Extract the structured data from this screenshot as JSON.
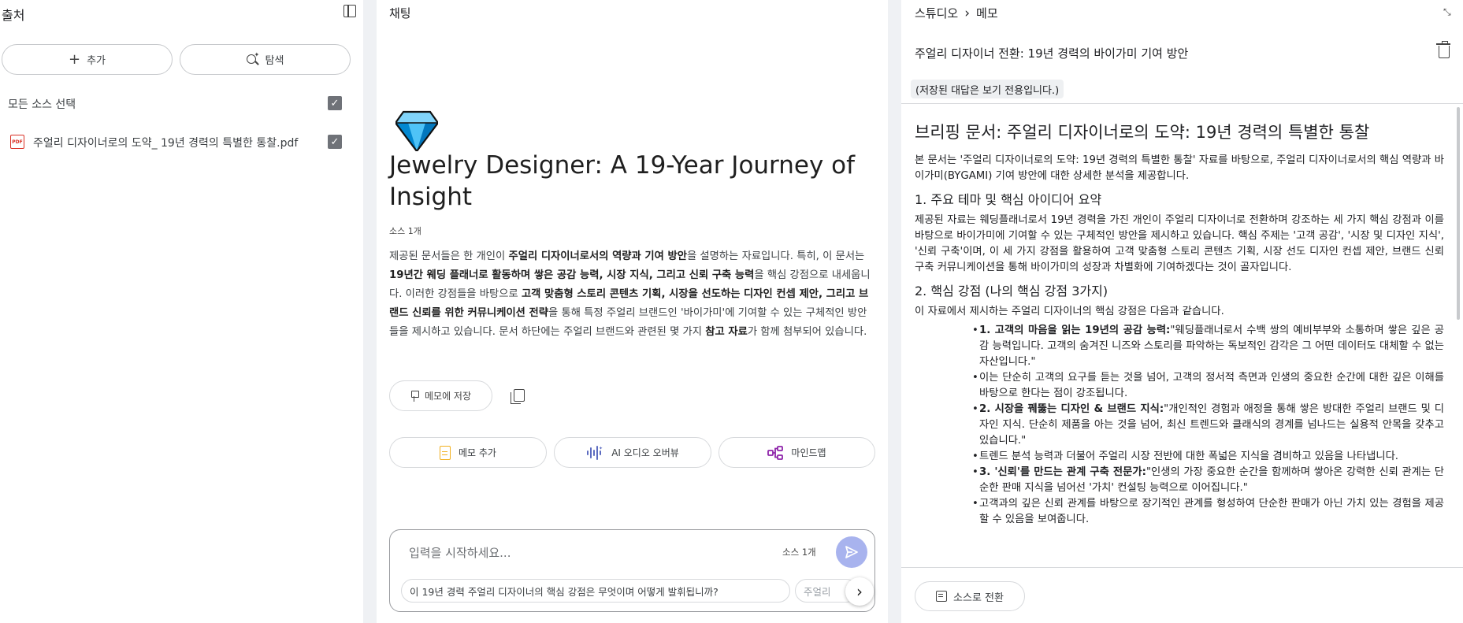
{
  "sources": {
    "title": "출처",
    "add_label": "추가",
    "explore_label": "탐색",
    "select_all_label": "모든 소스 선택",
    "items": [
      {
        "icon": "pdf-icon",
        "name": "주얼리 디자이너로의 도약_ 19년 경력의 특별한 통찰.pdf",
        "checked": true
      }
    ]
  },
  "chat": {
    "title": "채팅",
    "notebook_title": "Jewelry Designer: A 19-Year Journey of Insight",
    "source_count": "소스 1개",
    "save_memo_label": "메모에 저장",
    "actions": {
      "memo_add": "메모 추가",
      "audio": "AI 오디오 오버뷰",
      "mindmap": "마인드맵"
    },
    "input": {
      "placeholder": "입력을 시작하세요...",
      "source_count": "소스 1개"
    },
    "suggestions": [
      "이 19년 경력 주얼리 디자이너의 핵심 강점은 무엇이며 어떻게 발휘됩니까?",
      "주얼리"
    ]
  },
  "studio": {
    "crumb_root": "스튜디오",
    "crumb_leaf": "메모",
    "memo_title": "주얼리 디자이너 전환: 19년 경력의 바이가미 기여 방안",
    "readonly_notice": "(저장된 대답은 보기 전용입니다.)",
    "doc_title": "브리핑 문서: 주얼리 디자이너로의 도약: 19년 경력의 특별한 통찰",
    "intro": "본 문서는 '주얼리 디자이너로의 도약: 19년 경력의 특별한 통찰' 자료를 바탕으로, 주얼리 디자이너로서의 핵심 역량과 바이가미(BYGAMI) 기여 방안에 대한 상세한 분석을 제공합니다.",
    "section1_title": "1. 주요 테마 및 핵심 아이디어 요약",
    "section1_body": "제공된 자료는 웨딩플래너로서 19년 경력을 가진 개인이 주얼리 디자이너로 전환하며 강조하는 세 가지 핵심 강점과 이를 바탕으로 바이가미에 기여할 수 있는 구체적인 방안을 제시하고 있습니다. 핵심 주제는 '고객 공감', '시장 및 디자인 지식', '신뢰 구축'이며, 이 세 가지 강점을 활용하여 고객 맞춤형 스토리 콘텐츠 기획, 시장 선도 디자인 컨셉 제안, 브랜드 신뢰 구축 커뮤니케이션을 통해 바이가미의 성장과 차별화에 기여하겠다는 것이 골자입니다.",
    "section2_title": "2. 핵심 강점 (나의 핵심 강점 3가지)",
    "section2_intro": "이 자료에서 제시하는 주얼리 디자이너의 핵심 강점은 다음과 같습니다.",
    "bullets": [
      {
        "strong": "1. 고객의 마음을 읽는 19년의 공감 능력:",
        "text": "\"웨딩플래너로서 수백 쌍의 예비부부와 소통하며 쌓은 깊은 공감 능력입니다. 고객의 숨겨진 니즈와 스토리를 파악하는 독보적인 감각은 그 어떤 데이터도 대체할 수 없는 자산입니다.\""
      },
      {
        "strong": "",
        "text": "이는 단순히 고객의 요구를 듣는 것을 넘어, 고객의 정서적 측면과 인생의 중요한 순간에 대한 깊은 이해를 바탕으로 한다는 점이 강조됩니다."
      },
      {
        "strong": "2. 시장을 꿰뚫는 디자인 & 브랜드 지식:",
        "text": "\"개인적인 경험과 애정을 통해 쌓은 방대한 주얼리 브랜드 및 디자인 지식. 단순히 제품을 아는 것을 넘어, 최신 트렌드와 클래식의 경계를 넘나드는 실용적 안목을 갖추고 있습니다.\""
      },
      {
        "strong": "",
        "text": "트렌드 분석 능력과 더불어 주얼리 시장 전반에 대한 폭넓은 지식을 겸비하고 있음을 나타냅니다."
      },
      {
        "strong": "3. '신뢰'를 만드는 관계 구축 전문가:",
        "text": "\"인생의 가장 중요한 순간을 함께하며 쌓아온 강력한 신뢰 관계는 단순한 판매 지식을 넘어선 '가치' 컨설팅 능력으로 이어집니다.\""
      },
      {
        "strong": "",
        "text": "고객과의 깊은 신뢰 관계를 바탕으로 장기적인 관계를 형성하여 단순한 판매가 아닌 가치 있는 경험을 제공할 수 있음을 보여줍니다."
      }
    ],
    "to_source_label": "소스로 전환"
  },
  "colors": {
    "send_button": "#a8b3ee",
    "gem_light": "#4fc3f7",
    "gem_dark": "#0277bd",
    "memo_icon": "#f2b01e",
    "audio_icon": "#5c6bc0",
    "mindmap_icon": "#8e24aa",
    "pdf_icon": "#d93025"
  }
}
